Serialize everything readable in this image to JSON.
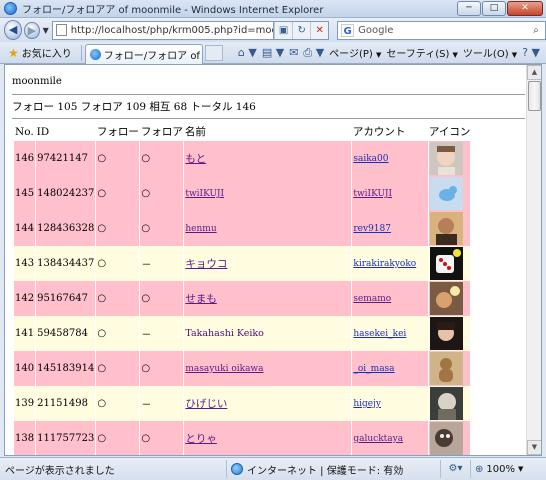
{
  "window": {
    "title": "フォロー/フォロアア of moonmile - Windows Internet Explorer",
    "minimize": "─",
    "maximize": "□",
    "close": "✕"
  },
  "nav": {
    "back_icon": "arrow-left-icon",
    "forward_icon": "arrow-right-icon",
    "url": "http://localhost/php/krm005.php?id=moo",
    "search_placeholder": "Google"
  },
  "command_bar": {
    "favorites_label": "お気に入り",
    "tab_label": "フォロー/フォロア of 005...",
    "page_menu": "ページ(P)",
    "safety_menu": "セーフティ(S)",
    "tools_menu": "ツール(O)",
    "help_menu": "?"
  },
  "page": {
    "owner": "moonmile",
    "counts_line": "フォロー 105 フォロア 109 相互 68 トータル 146",
    "columns": [
      "No.",
      "ID",
      "フォロー",
      "フォロア",
      "名前",
      "アカウント",
      "アイコン"
    ],
    "rows": [
      {
        "no": "146",
        "id": "97421147",
        "follow": "○",
        "follower": "○",
        "name": "もと",
        "account": "saika00",
        "style": "pink"
      },
      {
        "no": "145",
        "id": "148024237",
        "follow": "○",
        "follower": "○",
        "name": "twiIKUJI",
        "account": "twiIKUJI",
        "style": "pink"
      },
      {
        "no": "144",
        "id": "128436328",
        "follow": "○",
        "follower": "○",
        "name": "henmu",
        "account": "rev9187",
        "style": "pink"
      },
      {
        "no": "143",
        "id": "138434437",
        "follow": "○",
        "follower": "－",
        "name": "キョウコ",
        "account": "kirakirakyoko",
        "style": "cream"
      },
      {
        "no": "142",
        "id": "95167647",
        "follow": "○",
        "follower": "○",
        "name": "せまも",
        "account": "semamo",
        "style": "pink"
      },
      {
        "no": "141",
        "id": "59458784",
        "follow": "○",
        "follower": "－",
        "name": "Takahashi Keiko",
        "account": "hasekei_kei",
        "style": "cream"
      },
      {
        "no": "140",
        "id": "145183914",
        "follow": "○",
        "follower": "○",
        "name": "masayuki oikawa",
        "account": "_oi_masa",
        "style": "pink"
      },
      {
        "no": "139",
        "id": "21151498",
        "follow": "○",
        "follower": "－",
        "name": "ひげじい",
        "account": "higejy",
        "style": "cream"
      },
      {
        "no": "138",
        "id": "111757723",
        "follow": "○",
        "follower": "○",
        "name": "とりゃ",
        "account": "galucktaya",
        "style": "pink"
      }
    ]
  },
  "status": {
    "text": "ページが表示されました",
    "zone": "インターネット | 保護モード: 有効",
    "zoom": "100%"
  },
  "colors": {
    "mutual_row": "#ffc0cb",
    "oneway_row": "#fffce0"
  }
}
